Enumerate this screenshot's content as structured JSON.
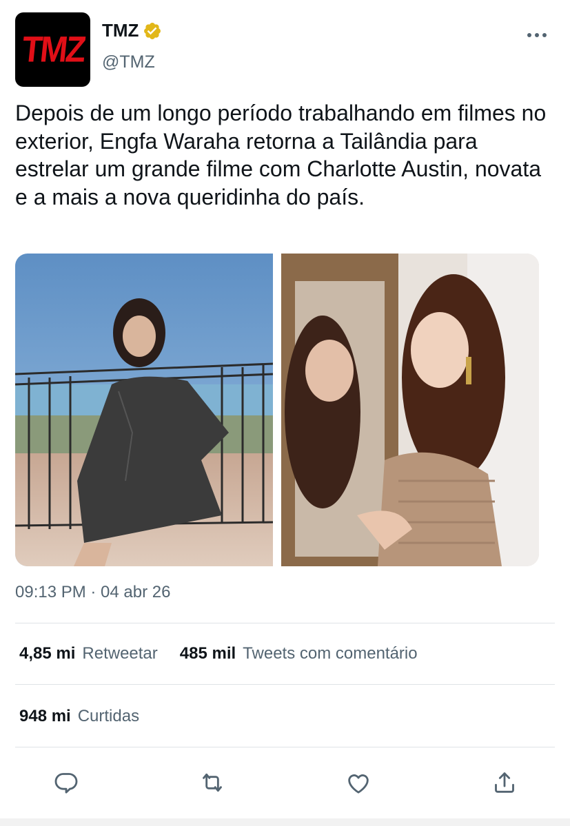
{
  "author": {
    "display_name": "TMZ",
    "handle": "@TMZ",
    "avatar_text": "TMZ",
    "verified": true
  },
  "tweet": {
    "text": "Depois de um longo período trabalhando em filmes no exterior, Engfa Waraha retorna a Tailândia para estrelar um grande filme com Charlotte Austin, novata e a mais a nova queridinha do país.",
    "timestamp": "09:13 PM · 04 abr 26"
  },
  "stats": {
    "retweets_count": "4,85 mi",
    "retweets_label": "Retweetar",
    "quotes_count": "485 mil",
    "quotes_label": "Tweets com comentário",
    "likes_count": "948 mi",
    "likes_label": "Curtidas"
  },
  "icons": {
    "more": "more-icon",
    "verified": "verified-badge-icon",
    "reply": "reply-icon",
    "retweet": "retweet-icon",
    "like": "like-icon",
    "share": "share-icon"
  },
  "colors": {
    "text": "#0f1419",
    "secondary": "#536471",
    "divider": "#dfe3e6",
    "verified_gold": "#e2b719",
    "brand_red": "#e10f17"
  }
}
